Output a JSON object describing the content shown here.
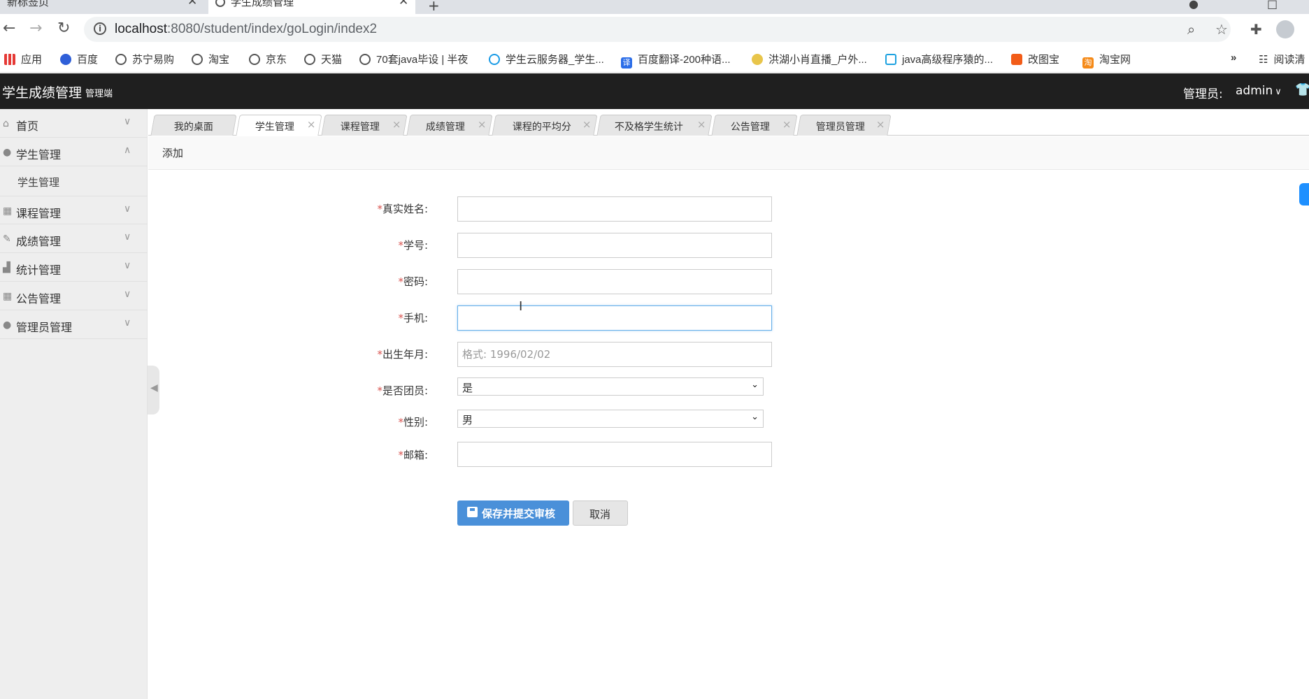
{
  "browser": {
    "tabs": [
      {
        "title": "新标签页"
      },
      {
        "title": "学生成绩管理"
      }
    ],
    "url_host": "localhost",
    "url_path": ":8080/student/index/goLogin/index2",
    "bookmarks": [
      {
        "label": "应用",
        "icon": "apps-icon"
      },
      {
        "label": "百度",
        "icon": "paw-icon"
      },
      {
        "label": "苏宁易购",
        "icon": "globe-icon"
      },
      {
        "label": "淘宝",
        "icon": "globe-icon"
      },
      {
        "label": "京东",
        "icon": "globe-icon"
      },
      {
        "label": "天猫",
        "icon": "globe-icon"
      },
      {
        "label": "70套java毕设 | 半夜",
        "icon": "globe-icon"
      },
      {
        "label": "学生云服务器_学生...",
        "icon": "cloud-icon"
      },
      {
        "label": "百度翻译-200种语...",
        "icon": "translate-icon"
      },
      {
        "label": "洪湖小肖直播_户外...",
        "icon": "bird-icon"
      },
      {
        "label": "java高级程序猿的...",
        "icon": "tv-icon"
      },
      {
        "label": "改图宝",
        "icon": "gaitubao-icon"
      },
      {
        "label": "淘宝网",
        "icon": "taobao-icon"
      }
    ],
    "reading_list": "阅读清"
  },
  "header": {
    "title": "学生成绩管理",
    "subtitle": "管理端",
    "admin_label": "管理员:",
    "admin_name": "admin"
  },
  "sidebar": {
    "items": [
      {
        "label": "首页",
        "icon": "home-icon"
      },
      {
        "label": "学生管理",
        "icon": "user-icon",
        "expanded": true
      },
      {
        "label": "课程管理",
        "icon": "table-icon"
      },
      {
        "label": "成绩管理",
        "icon": "edit-icon"
      },
      {
        "label": "统计管理",
        "icon": "chart-icon"
      },
      {
        "label": "公告管理",
        "icon": "table-icon"
      },
      {
        "label": "管理员管理",
        "icon": "user-icon"
      }
    ],
    "sub_item": "学生管理"
  },
  "page_tabs": [
    {
      "label": "我的桌面",
      "closable": false
    },
    {
      "label": "学生管理",
      "closable": true,
      "active": true
    },
    {
      "label": "课程管理",
      "closable": true
    },
    {
      "label": "成绩管理",
      "closable": true
    },
    {
      "label": "课程的平均分",
      "closable": true
    },
    {
      "label": "不及格学生统计",
      "closable": true
    },
    {
      "label": "公告管理",
      "closable": true
    },
    {
      "label": "管理员管理",
      "closable": true
    }
  ],
  "content": {
    "section_title": "添加"
  },
  "form": {
    "required_mark": "*",
    "fields": {
      "real_name": {
        "label": "真实姓名:",
        "value": ""
      },
      "student_no": {
        "label": "学号:",
        "value": ""
      },
      "password": {
        "label": "密码:",
        "value": ""
      },
      "phone": {
        "label": "手机:",
        "value": ""
      },
      "birth": {
        "label": "出生年月:",
        "placeholder": "格式: 1996/02/02"
      },
      "league_member": {
        "label": "是否团员:",
        "value": "是"
      },
      "gender": {
        "label": "性别:",
        "value": "男"
      },
      "email": {
        "label": "邮箱:",
        "value": ""
      }
    },
    "save_label": "保存并提交审核",
    "cancel_label": "取消"
  }
}
